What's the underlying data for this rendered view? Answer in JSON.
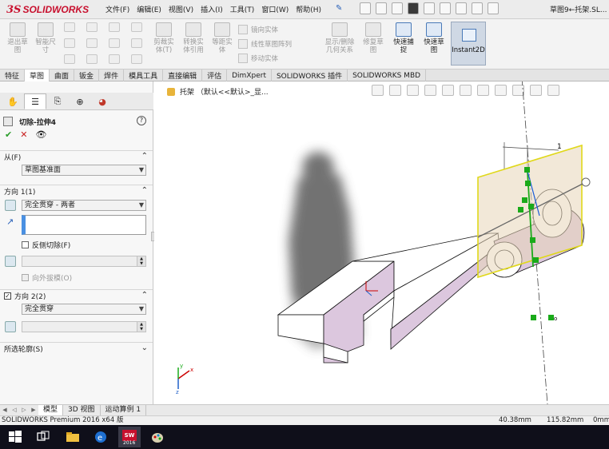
{
  "app": {
    "logo_mark": "3S",
    "logo_text": "SOLIDWORKS",
    "doc_title": "草图9←托架.SL...",
    "menus": [
      "文件(F)",
      "编辑(E)",
      "视图(V)",
      "插入(I)",
      "工具(T)",
      "窗口(W)",
      "帮助(H)"
    ]
  },
  "commands": {
    "exit_sketch": "退出草\n图",
    "smart_dimension": "智能尺\n寸",
    "trim": "剪裁实\n体(T)",
    "convert": "转换实\n体引用",
    "offset": "等距实\n体",
    "mirror": "镜向实体",
    "linear_pattern": "线性草图阵列",
    "move": "移动实体",
    "display_relations": "显示/删除\n几何关系",
    "repair_sketch": "修复草\n图",
    "quick_snaps": "快速捕\n捉",
    "rapid_sketch": "快速草\n图",
    "instant2d": "Instant2D"
  },
  "tabs": [
    {
      "label": "特征",
      "active": false
    },
    {
      "label": "草图",
      "active": true
    },
    {
      "label": "曲面",
      "active": false
    },
    {
      "label": "钣金",
      "active": false
    },
    {
      "label": "焊件",
      "active": false
    },
    {
      "label": "模具工具",
      "active": false
    },
    {
      "label": "直接编辑",
      "active": false
    },
    {
      "label": "评估",
      "active": false
    },
    {
      "label": "DimXpert",
      "active": false
    },
    {
      "label": "SOLIDWORKS 插件",
      "active": false
    },
    {
      "label": "SOLIDWORKS MBD",
      "active": false
    }
  ],
  "property_manager": {
    "title": "切除-拉伸4",
    "from": {
      "header": "从(F)",
      "value": "草图基准面"
    },
    "direction1": {
      "header": "方向 1(1)",
      "end_condition": "完全贯穿 - 两者",
      "flip_side": "反侧切除(F)",
      "draft_outward": "向外拔模(O)"
    },
    "direction2": {
      "header": "方向 2(2)",
      "checked": true,
      "end_condition": "完全贯穿"
    },
    "selected_contours": "所选轮廓(S)"
  },
  "viewport": {
    "breadcrumb": "托架 （默认<<默认>_显...",
    "dimension_label": "1"
  },
  "bottom_tabs": [
    "模型",
    "3D 视图",
    "运动算例 1"
  ],
  "status": {
    "product": "SOLIDWORKS Premium 2016 x64 版",
    "x": "40.38mm",
    "y": "115.82mm",
    "z": "0mm"
  },
  "taskbar": {
    "sw_badge": "2016"
  },
  "colors": {
    "accent": "#4a90e2",
    "brand": "#c8102e",
    "sketch_green": "#1aaa1a",
    "face_purple": "#ddc8e0"
  }
}
